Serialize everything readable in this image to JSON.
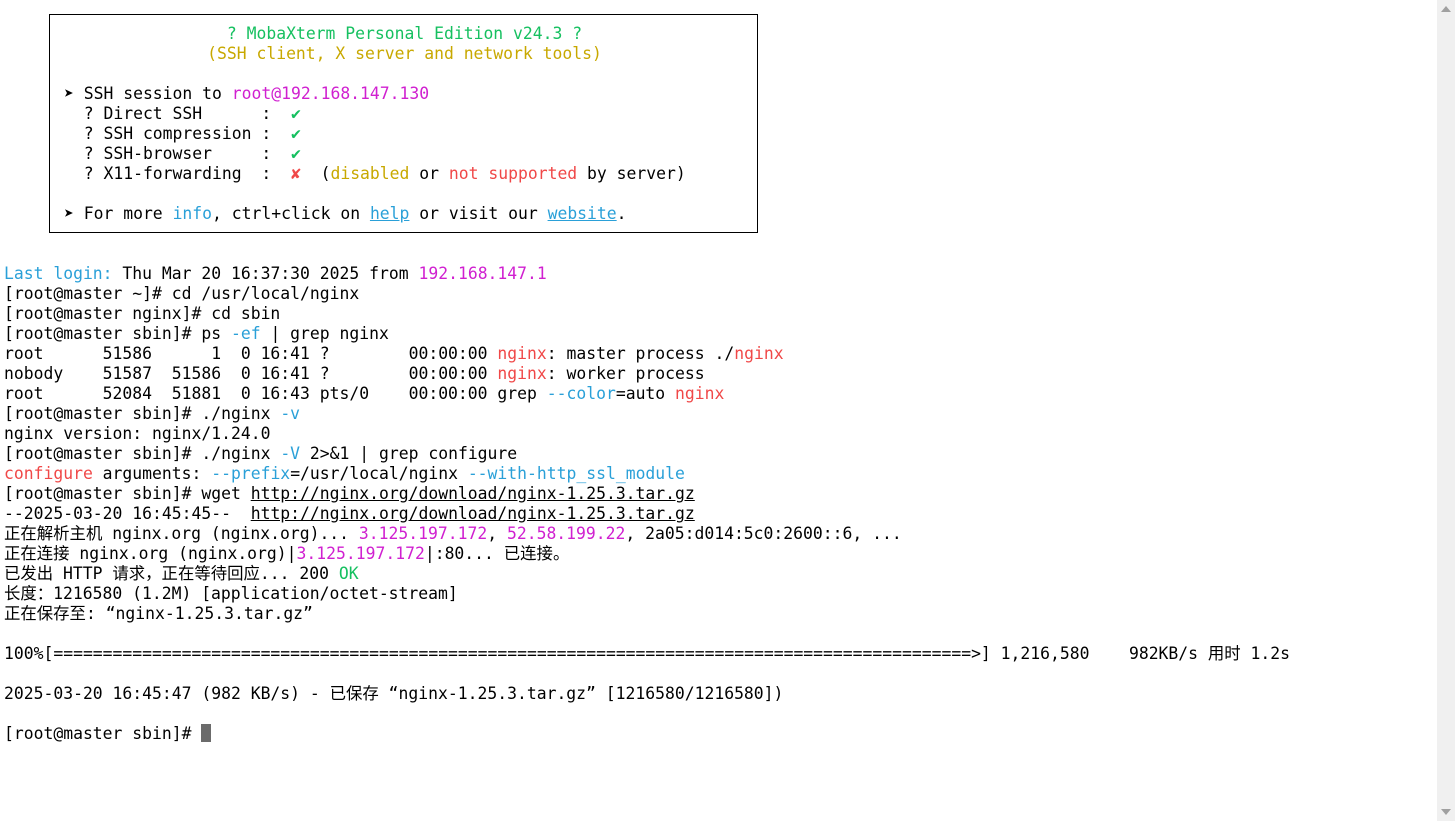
{
  "banner": {
    "title": "? MobaXterm Personal Edition v24.3 ?",
    "subtitle": "(SSH client, X server and network tools)",
    "session_prefix": "➤ SSH session to ",
    "session_target": "root@192.168.147.130",
    "features": [
      {
        "label": "  ? Direct SSH      :  ",
        "status": "✔"
      },
      {
        "label": "  ? SSH compression :  ",
        "status": "✔"
      },
      {
        "label": "  ? SSH-browser     :  ",
        "status": "✔"
      },
      {
        "label": "  ? X11-forwarding  :  ",
        "status": "✘"
      }
    ],
    "x11_note": {
      "open": "  (",
      "disabled": "disabled",
      "or": " or ",
      "not_supported": "not supported",
      "tail": " by server)"
    },
    "more_prefix": "➤ For more ",
    "more_info": "info",
    "more_mid": ", ctrl+click on ",
    "more_help": "help",
    "more_mid2": " or visit our ",
    "more_website": "website",
    "more_end": "."
  },
  "terminal": {
    "last_login_label": "Last login:",
    "last_login_text": " Thu Mar 20 16:37:30 2025 from ",
    "last_login_ip": "192.168.147.1",
    "l1": "[root@master ~]# cd /usr/local/nginx",
    "l2": "[root@master nginx]# cd sbin",
    "l3_a": "[root@master sbin]# ps ",
    "l3_b": "-ef",
    "l3_c": " | grep nginx",
    "ps1_a": "root      51586      1  0 16:41 ?        00:00:00 ",
    "ps1_b": "nginx",
    "ps1_c": ": master process ./",
    "ps1_d": "nginx",
    "ps2_a": "nobody    51587  51586  0 16:41 ?        00:00:00 ",
    "ps2_b": "nginx",
    "ps2_c": ": worker process",
    "ps3_a": "root      52084  51881  0 16:43 pts/0    00:00:00 grep ",
    "ps3_b": "--color",
    "ps3_c": "=auto ",
    "ps3_d": "nginx",
    "l4_a": "[root@master sbin]# ./nginx ",
    "l4_b": "-v",
    "l5": "nginx version: nginx/1.24.0",
    "l6_a": "[root@master sbin]# ./nginx ",
    "l6_b": "-V",
    "l6_c": " 2>&1 | grep configure",
    "l7_a": "configure",
    "l7_b": " arguments: ",
    "l7_c": "--prefix",
    "l7_d": "=/usr/local/nginx ",
    "l7_e": "--with-http_ssl_module",
    "l8_a": "[root@master sbin]# wget ",
    "l8_b": "http://nginx.org/download/nginx-1.25.3.tar.gz",
    "l9_a": "--2025-03-20 16:45:45--  ",
    "l9_b": "http://nginx.org/download/nginx-1.25.3.tar.gz",
    "l10_a": "正在解析主机 nginx.org (nginx.org)... ",
    "l10_b": "3.125.197.172",
    "l10_c": ", ",
    "l10_d": "52.58.199.22",
    "l10_e": ", 2a05:d014:5c0:2600::6, ...",
    "l11_a": "正在连接 nginx.org (nginx.org)|",
    "l11_b": "3.125.197.172",
    "l11_c": "|:80... 已连接。",
    "l12_a": "已发出 HTTP 请求，正在等待回应... 200 ",
    "l12_b": "OK",
    "l13": "长度：1216580 (1.2M) [application/octet-stream]",
    "l14": "正在保存至: “nginx-1.25.3.tar.gz”",
    "progress": "100%[=============================================================================================>] 1,216,580    982KB/s 用时 1.2s",
    "saved": "2025-03-20 16:45:47 (982 KB/s) - 已保存 “nginx-1.25.3.tar.gz” [1216580/1216580])",
    "prompt": "[root@master sbin]# "
  }
}
